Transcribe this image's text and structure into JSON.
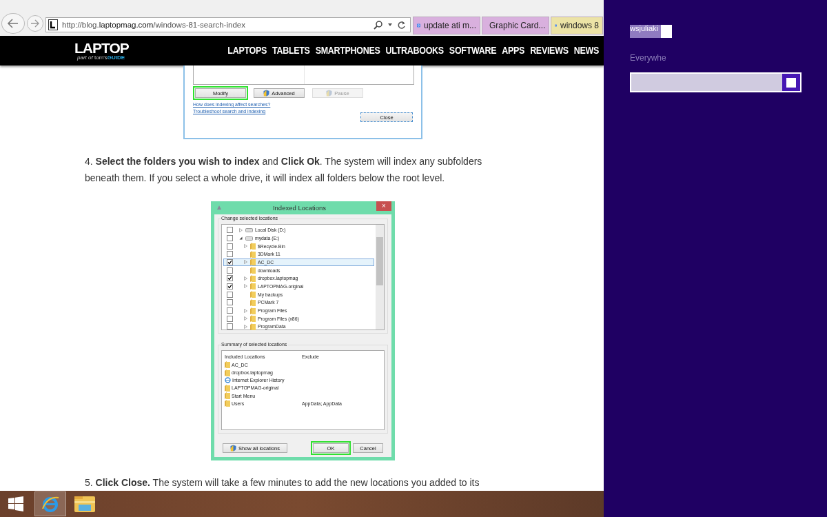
{
  "browser": {
    "address": {
      "prefix": "http://blog.",
      "domain": "laptopmag.com",
      "path": "/windows-81-search-index"
    },
    "tabs": [
      {
        "label": "update ati m...",
        "color": "#d9b0de",
        "kind": "search"
      },
      {
        "label": "Graphic Card...",
        "color": "#d9b0de",
        "kind": "tiles"
      },
      {
        "label": "windows 8",
        "color": "#ece3a6",
        "kind": "search"
      }
    ]
  },
  "site": {
    "logo": "LAPTOP",
    "logo_sub_prefix": "part of",
    "logo_sub_brand": "tom's",
    "logo_sub_guide": "GUIDE",
    "nav": [
      "LAPTOPS",
      "TABLETS",
      "SMARTPHONES",
      "ULTRABOOKS",
      "SOFTWARE",
      "APPS",
      "REVIEWS",
      "NEWS"
    ]
  },
  "figure_1": {
    "buttons": [
      {
        "label": "Modify",
        "highlighted": true,
        "disabled": false,
        "shield": false
      },
      {
        "label": "Advanced",
        "highlighted": false,
        "disabled": false,
        "shield": true
      },
      {
        "label": "Pause",
        "highlighted": false,
        "disabled": true,
        "shield": true
      }
    ],
    "links": [
      "How does indexing affect searches?",
      "Troubleshoot search and indexing"
    ],
    "close": "Close"
  },
  "step_4": "4. **Select the folders you wish to index** and **Click Ok**. The system will index any subfolders beneath them. If you select a whole drive, it will index all folders below the root level.",
  "figure_2": {
    "title": "Indexed Locations",
    "close": "×",
    "group_1": "Change selected locations",
    "tree": [
      {
        "label": "Local Disk (D:)",
        "kind": "drive",
        "checked": false,
        "expandable": true,
        "expanded": false,
        "selected": false
      },
      {
        "label": "mydata (E:)",
        "kind": "drive",
        "checked": false,
        "expandable": true,
        "expanded": true,
        "selected": false,
        "children": [
          {
            "label": "$Recycle.Bin",
            "kind": "folder",
            "checked": false,
            "expandable": true,
            "expanded": false,
            "selected": false
          },
          {
            "label": "3DMark 11",
            "kind": "folder",
            "checked": false,
            "expandable": false,
            "selected": false
          },
          {
            "label": "AC_DC",
            "kind": "folder",
            "checked": true,
            "expandable": true,
            "expanded": false,
            "selected": true
          },
          {
            "label": "downloads",
            "kind": "folder",
            "checked": false,
            "expandable": false,
            "selected": false
          },
          {
            "label": "dropbox.laptopmag",
            "kind": "folder",
            "checked": true,
            "expandable": true,
            "expanded": false,
            "selected": false
          },
          {
            "label": "LAPTOPMAG-original",
            "kind": "folder",
            "checked": true,
            "expandable": true,
            "expanded": false,
            "selected": false
          },
          {
            "label": "My backups",
            "kind": "folder",
            "checked": false,
            "expandable": false,
            "selected": false
          },
          {
            "label": "PCMark 7",
            "kind": "folder",
            "checked": false,
            "expandable": false,
            "selected": false
          },
          {
            "label": "Program Files",
            "kind": "folder",
            "checked": false,
            "expandable": true,
            "expanded": false,
            "selected": false
          },
          {
            "label": "Program Files (x86)",
            "kind": "folder",
            "checked": false,
            "expandable": true,
            "expanded": false,
            "selected": false
          },
          {
            "label": "ProgramData",
            "kind": "folder",
            "checked": false,
            "expandable": true,
            "expanded": false,
            "selected": false
          }
        ]
      }
    ],
    "group_2": "Summary of selected locations",
    "columns": [
      "Included Locations",
      "Exclude"
    ],
    "rows": [
      {
        "name": "AC_DC",
        "kind": "folder"
      },
      {
        "name": "dropbox.laptopmag",
        "kind": "folder"
      },
      {
        "name": "Internet Explorer History",
        "kind": "history"
      },
      {
        "name": "LAPTOPMAG-original",
        "kind": "folder"
      },
      {
        "name": "Start Menu",
        "kind": "folder"
      },
      {
        "name": "Users",
        "kind": "folder",
        "exclude": "AppData; AppData"
      }
    ],
    "buttons": [
      {
        "label": "Show all locations",
        "highlighted": false,
        "shield": true
      },
      {
        "label": "OK",
        "highlighted": true,
        "shield": false
      },
      {
        "label": "Cancel",
        "highlighted": false,
        "shield": false
      }
    ]
  },
  "step_5": "5. **Click Close.** The system will take a few minutes to add the new locations you added to its",
  "charm": {
    "heading": "wsjuliaki",
    "scope": "Everywhe"
  },
  "taskbar": [
    {
      "kind": "start",
      "active": false
    },
    {
      "kind": "ie",
      "active": true
    },
    {
      "kind": "explorer",
      "active": false
    }
  ]
}
